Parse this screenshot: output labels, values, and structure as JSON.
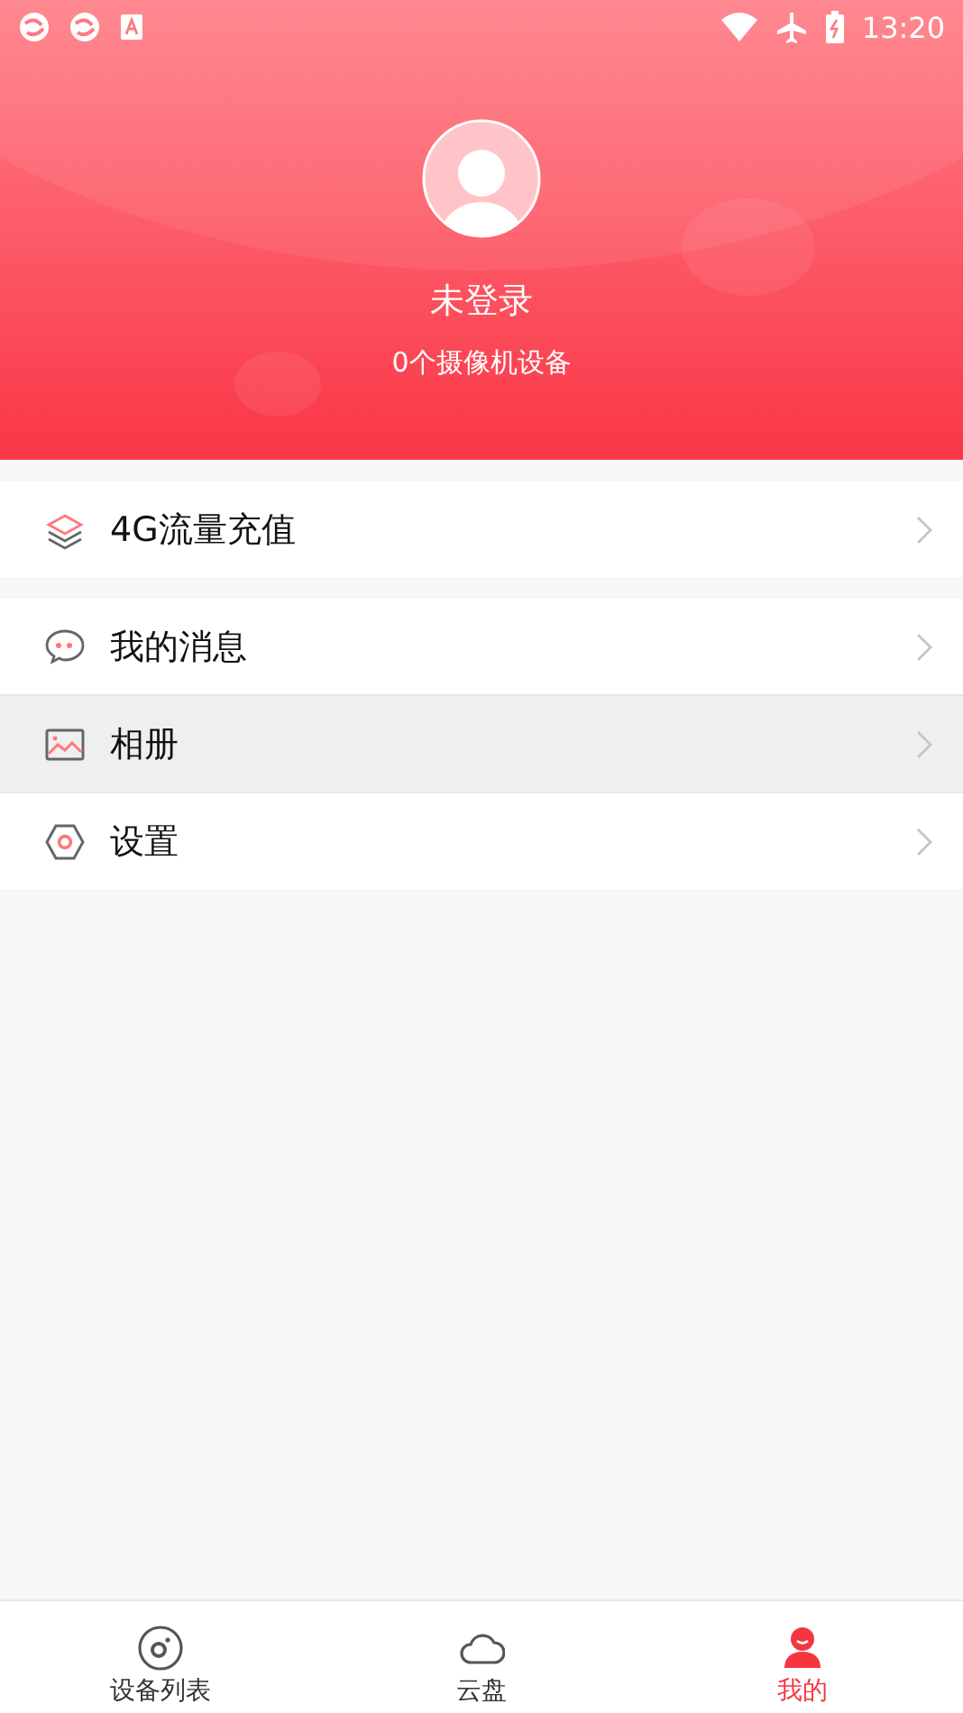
{
  "status_bar": {
    "time": "13:20"
  },
  "profile": {
    "name": "未登录",
    "subtitle": "0个摄像机设备"
  },
  "menu_groups": [
    [
      {
        "kind": "layers",
        "label": "4G流量充值",
        "selected": false
      }
    ],
    [
      {
        "kind": "chat",
        "label": "我的消息",
        "selected": false
      },
      {
        "kind": "photo",
        "label": "相册",
        "selected": true
      },
      {
        "kind": "settings",
        "label": "设置",
        "selected": false
      }
    ]
  ],
  "tabs": [
    {
      "kind": "camera",
      "label": "设备列表",
      "selected": false
    },
    {
      "kind": "cloud",
      "label": "云盘",
      "selected": false
    },
    {
      "kind": "person",
      "label": "我的",
      "selected": true
    }
  ]
}
